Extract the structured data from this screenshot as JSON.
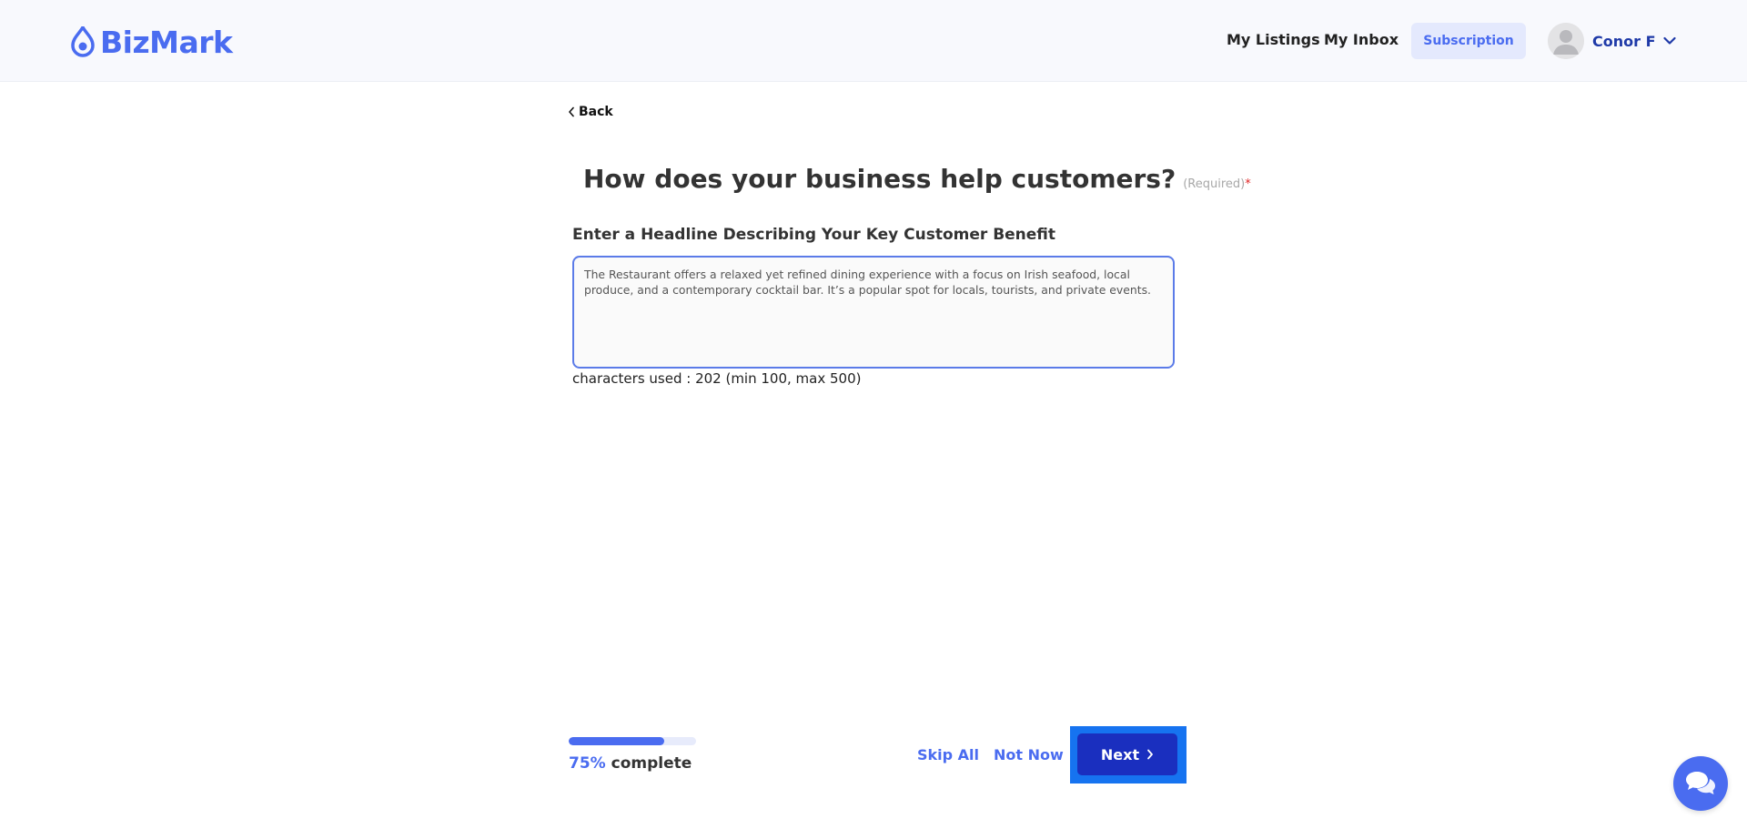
{
  "brand": {
    "name": "BizMark",
    "color": "#4a6cf0"
  },
  "header": {
    "nav": [
      {
        "label": "My Listings"
      },
      {
        "label": "My Inbox"
      }
    ],
    "subscription_label": "Subscription",
    "user": {
      "name": "Conor F",
      "avatar_icon": "user-avatar-icon"
    }
  },
  "main": {
    "back_label": "Back",
    "question": "How does your business help customers?",
    "required_label": "(Required)",
    "required_marker": "*",
    "field_label": "Enter a Headline Describing Your Key Customer Benefit",
    "field_value": "The Restaurant offers a relaxed yet refined dining experience with a focus on Irish seafood, local produce, and a contemporary cocktail bar. It’s a popular spot for locals, tourists, and private events.",
    "char_count_text": "characters used : 202 (min 100, max 500)"
  },
  "footer": {
    "progress_percent": 75,
    "progress_label": "75%",
    "progress_suffix": "complete",
    "skip_all_label": "Skip All",
    "not_now_label": "Not Now",
    "next_label": "Next"
  },
  "colors": {
    "accent": "#4a6cf0",
    "primary_button": "#1a2fbf",
    "focus_outline": "#1673f0",
    "required": "#e02424"
  }
}
